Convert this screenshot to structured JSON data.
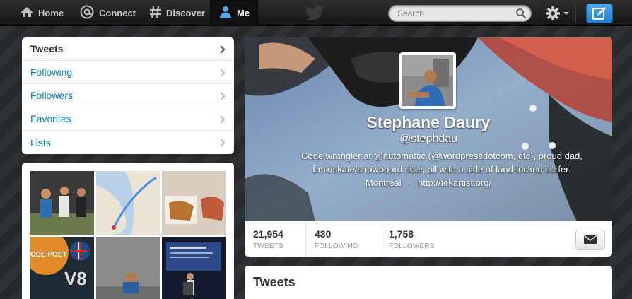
{
  "topbar": {
    "nav": [
      {
        "label": "Home",
        "icon": "home-icon"
      },
      {
        "label": "Connect",
        "icon": "at-icon"
      },
      {
        "label": "Discover",
        "icon": "hash-icon"
      },
      {
        "label": "Me",
        "icon": "person-icon"
      }
    ],
    "search_placeholder": "Search",
    "accent": "#2d8ddc"
  },
  "sidebar": {
    "items": [
      {
        "label": "Tweets"
      },
      {
        "label": "Following"
      },
      {
        "label": "Followers"
      },
      {
        "label": "Favorites"
      },
      {
        "label": "Lists"
      }
    ]
  },
  "profile": {
    "name": "Stephane Daury",
    "handle": "@stephdau",
    "bio_line1": "Code wrangler at @automattic (@wordpressdotcom, etc), proud dad,",
    "bio_line2": "bmx/skate/snowboard rider, all with a side of land-locked surfer.",
    "location": "Montréal",
    "separator": "·",
    "url": "http://tekartist.org/"
  },
  "stats": [
    {
      "value": "21,954",
      "label": "TWEETS"
    },
    {
      "value": "430",
      "label": "FOLLOWING"
    },
    {
      "value": "1,758",
      "label": "FOLLOWERS"
    }
  ],
  "timeline": {
    "heading": "Tweets"
  },
  "media_thumb_overlay": {
    "v8": "V8",
    "code_poet": "ODE POET"
  }
}
